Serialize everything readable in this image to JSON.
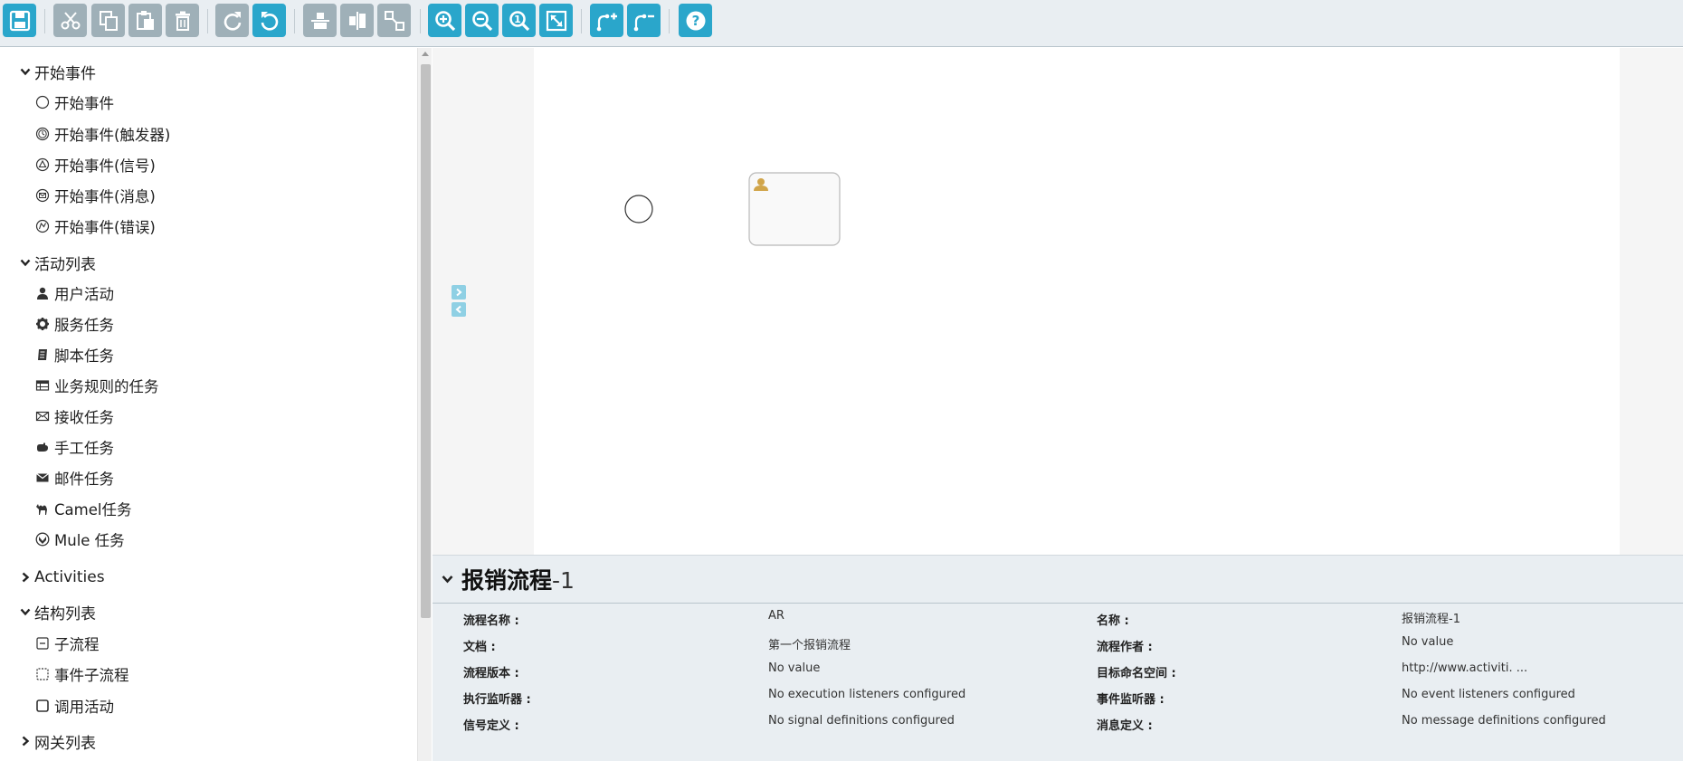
{
  "toolbar": {
    "buttons": [
      {
        "id": "save",
        "icon": "save-icon",
        "color": "blue"
      },
      {
        "id": "cut",
        "icon": "cut-icon",
        "color": "gray"
      },
      {
        "id": "copy",
        "icon": "copy-icon",
        "color": "gray"
      },
      {
        "id": "paste",
        "icon": "paste-icon",
        "color": "gray"
      },
      {
        "id": "delete",
        "icon": "trash-icon",
        "color": "gray"
      },
      {
        "id": "redo",
        "icon": "redo-icon",
        "color": "gray"
      },
      {
        "id": "undo",
        "icon": "undo-icon",
        "color": "blue"
      },
      {
        "id": "align-horizontal",
        "icon": "align-horizontal-icon",
        "color": "gray"
      },
      {
        "id": "align-vertical",
        "icon": "align-vertical-icon",
        "color": "gray"
      },
      {
        "id": "same-size",
        "icon": "same-size-icon",
        "color": "gray"
      },
      {
        "id": "zoom-in",
        "icon": "zoom-in-icon",
        "color": "blue"
      },
      {
        "id": "zoom-out",
        "icon": "zoom-out-icon",
        "color": "blue"
      },
      {
        "id": "zoom-actual",
        "icon": "zoom-actual-icon",
        "color": "blue"
      },
      {
        "id": "zoom-fit",
        "icon": "zoom-fit-icon",
        "color": "blue"
      },
      {
        "id": "add-bendpoint",
        "icon": "add-bendpoint-icon",
        "color": "blue"
      },
      {
        "id": "remove-bendpoint",
        "icon": "remove-bendpoint-icon",
        "color": "blue"
      },
      {
        "id": "help",
        "icon": "help-icon",
        "color": "blue"
      }
    ]
  },
  "palette": {
    "groups": [
      {
        "label": "开始事件",
        "expanded": true,
        "items": [
          {
            "label": "开始事件",
            "icon": "start-event-icon"
          },
          {
            "label": "开始事件(触发器)",
            "icon": "timer-start-icon"
          },
          {
            "label": "开始事件(信号)",
            "icon": "signal-start-icon"
          },
          {
            "label": "开始事件(消息)",
            "icon": "message-start-icon"
          },
          {
            "label": "开始事件(错误)",
            "icon": "error-start-icon"
          }
        ]
      },
      {
        "label": "活动列表",
        "expanded": true,
        "items": [
          {
            "label": "用户活动",
            "icon": "user-icon"
          },
          {
            "label": "服务任务",
            "icon": "gear-icon"
          },
          {
            "label": "脚本任务",
            "icon": "script-icon"
          },
          {
            "label": "业务规则的任务",
            "icon": "table-icon"
          },
          {
            "label": "接收任务",
            "icon": "envelope-open-icon"
          },
          {
            "label": "手工任务",
            "icon": "hand-icon"
          },
          {
            "label": "邮件任务",
            "icon": "envelope-icon"
          },
          {
            "label": "Camel任务",
            "icon": "camel-icon"
          },
          {
            "label": "Mule 任务",
            "icon": "mule-icon"
          }
        ]
      },
      {
        "label": "Activities",
        "expanded": false,
        "items": []
      },
      {
        "label": "结构列表",
        "expanded": true,
        "items": [
          {
            "label": "子流程",
            "icon": "subprocess-icon"
          },
          {
            "label": "事件子流程",
            "icon": "event-subprocess-icon"
          },
          {
            "label": "调用活动",
            "icon": "call-activity-icon"
          }
        ]
      },
      {
        "label": "网关列表",
        "expanded": false,
        "items": []
      }
    ]
  },
  "properties": {
    "title_main": "报销流程",
    "title_ver": "-1",
    "rows": [
      {
        "k1": "流程名称 :",
        "v1": "AR",
        "k2": "名称 :",
        "v2": "报销流程-1"
      },
      {
        "k1": "文档 :",
        "v1": "第一个报销流程",
        "k2": "流程作者 :",
        "v2": "No value"
      },
      {
        "k1": "流程版本 :",
        "v1": "No value",
        "k2": "目标命名空间 :",
        "v2": "http://www.activiti. ..."
      },
      {
        "k1": "执行监听器 :",
        "v1": "No execution listeners configured",
        "k2": "事件监听器 :",
        "v2": "No event listeners configured"
      },
      {
        "k1": "信号定义 :",
        "v1": "No signal definitions configured",
        "k2": "消息定义 :",
        "v2": "No message definitions configured"
      }
    ]
  },
  "colors": {
    "accent": "#2aa6cb",
    "disabled": "#9fb0b8",
    "panel_bg": "#e9eef2",
    "task_border": "#b9b9b9",
    "user_icon": "#d1a54a"
  }
}
